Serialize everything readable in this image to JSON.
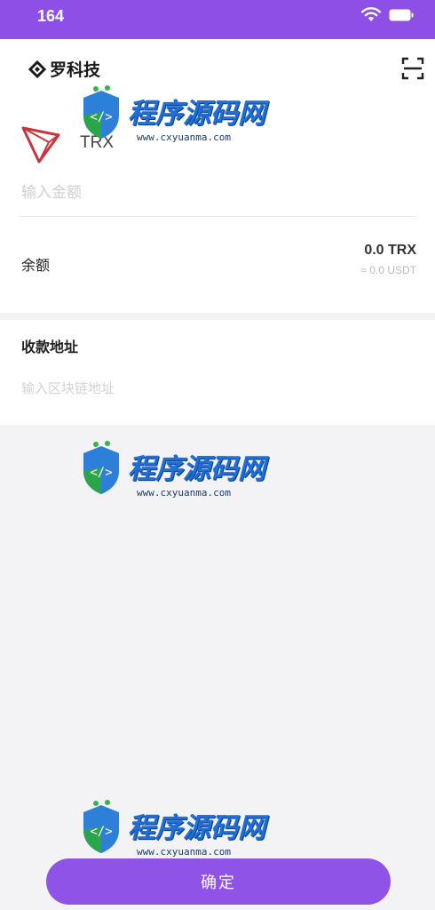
{
  "status_bar": {
    "time": "164",
    "icons": [
      "wifi-icon",
      "battery-icon"
    ],
    "background": "#8e4fe6"
  },
  "header": {
    "brand_icon": "diamond-logo-icon",
    "brand_name": "罗科技",
    "scan_icon": "scan-icon"
  },
  "token": {
    "icon": "tron-logo-icon",
    "symbol": "TRX"
  },
  "amount": {
    "placeholder": "输入金额",
    "value": ""
  },
  "balance": {
    "label": "余额",
    "value": "0.0 TRX",
    "fiat": "≈ 0.0 USDT"
  },
  "address": {
    "label": "收款地址",
    "placeholder": "输入区块链地址",
    "value": ""
  },
  "confirm_button": {
    "label": "确定",
    "color": "#9053e8"
  },
  "watermark": {
    "title": "程序源码网",
    "url": "www.cxyuanma.com"
  }
}
